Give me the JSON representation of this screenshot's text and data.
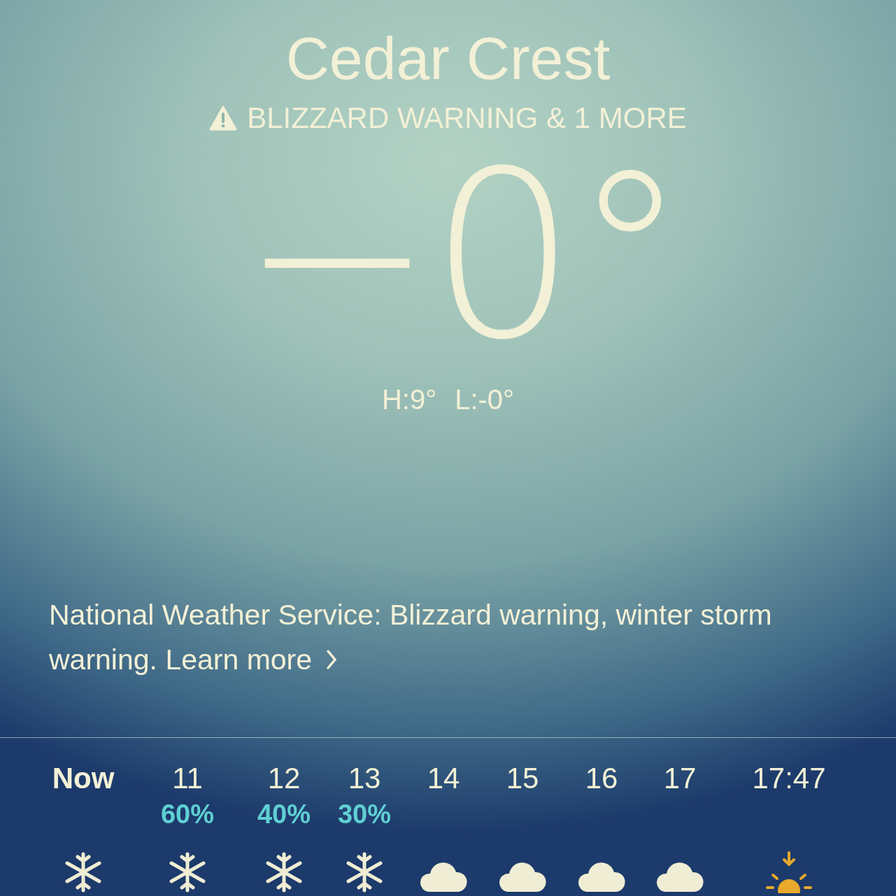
{
  "location": "Cedar Crest",
  "alert": {
    "label": "BLIZZARD WARNING & 1 MORE"
  },
  "temperature": "−0°",
  "high_low": {
    "high": "H:9°",
    "low": "L:-0°"
  },
  "notice": {
    "text": "National Weather Service: Blizzard warning, winter storm warning.",
    "link": "Learn more"
  },
  "hourly": [
    {
      "time": "Now",
      "kind": "snow"
    },
    {
      "time": "11",
      "precip": "60%",
      "kind": "snow"
    },
    {
      "time": "12",
      "precip": "40%",
      "kind": "snow"
    },
    {
      "time": "13",
      "precip": "30%",
      "kind": "snow"
    },
    {
      "time": "14",
      "kind": "cloud"
    },
    {
      "time": "15",
      "kind": "cloud"
    },
    {
      "time": "16",
      "kind": "cloud"
    },
    {
      "time": "17",
      "kind": "cloud"
    },
    {
      "time": "17:47",
      "kind": "sunset"
    }
  ]
}
